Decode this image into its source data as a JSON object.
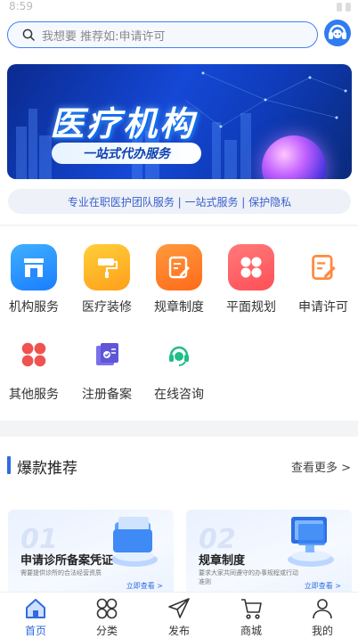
{
  "status_bar": {
    "time": "8:59"
  },
  "search": {
    "placeholder": "我想要 推荐如:申请许可"
  },
  "banner": {
    "title": "医疗机构",
    "subtitle": "一站式代办服务",
    "dot_count": 3,
    "active_dot": 0
  },
  "tagline": "专业在职医护团队服务 | 一站式服务 | 保护隐私",
  "services": [
    {
      "label": "机构服务",
      "icon": "building-icon",
      "color": "#1a8cff"
    },
    {
      "label": "医疗装修",
      "icon": "paint-roller-icon",
      "color": "#ffb21a"
    },
    {
      "label": "规章制度",
      "icon": "edit-document-icon",
      "color": "#ff7a1a"
    },
    {
      "label": "平面规划",
      "icon": "grid-icon",
      "color": "#ff5a5f"
    },
    {
      "label": "申请许可",
      "icon": "edit-document-icon",
      "color": "#ff8a3d"
    },
    {
      "label": "其他服务",
      "icon": "grid-icon",
      "color": "#f0524f"
    },
    {
      "label": "注册备案",
      "icon": "certificate-icon",
      "color": "#6b63e0"
    },
    {
      "label": "在线咨询",
      "icon": "headset-icon",
      "color": "#1fbe88"
    }
  ],
  "hot": {
    "title": "爆款推荐",
    "more": "查看更多 >",
    "cards": [
      {
        "num": "01",
        "title": "申请诊所备案凭证",
        "desc": "需要提供诊所的合法经营资质",
        "button": "立即查看 >"
      },
      {
        "num": "02",
        "title": "规章制度",
        "desc": "要求大家共同遵守的办事规程或行动准则",
        "button": "立即查看 >"
      }
    ]
  },
  "tabbar": [
    {
      "label": "首页",
      "icon": "home-icon",
      "active": true
    },
    {
      "label": "分类",
      "icon": "category-icon",
      "active": false
    },
    {
      "label": "发布",
      "icon": "send-icon",
      "active": false
    },
    {
      "label": "商城",
      "icon": "cart-icon",
      "active": false
    },
    {
      "label": "我的",
      "icon": "user-icon",
      "active": false
    }
  ],
  "colors": {
    "accent": "#2f6be0",
    "search_border": "#3b82f6"
  }
}
